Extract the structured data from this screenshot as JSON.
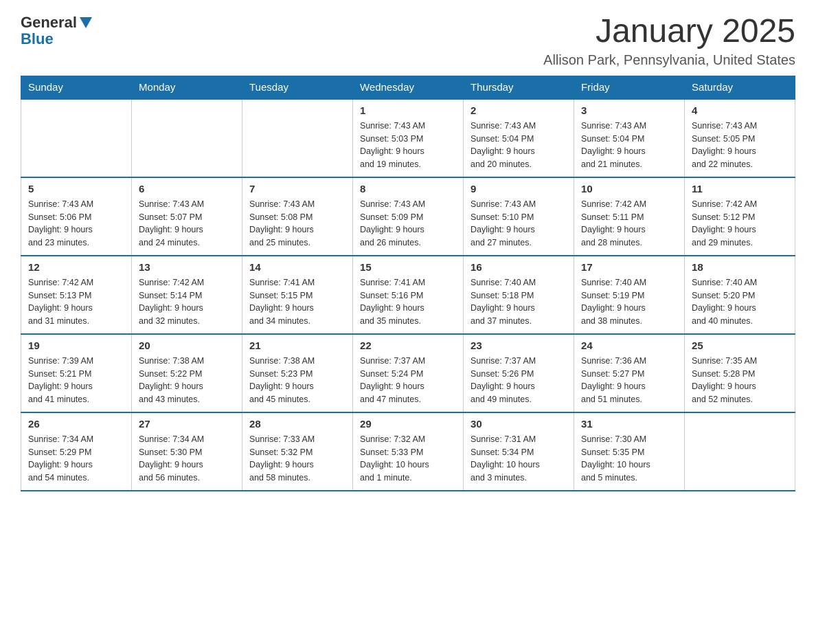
{
  "header": {
    "logo": {
      "general": "General",
      "blue": "Blue"
    },
    "month_title": "January 2025",
    "location": "Allison Park, Pennsylvania, United States"
  },
  "weekdays": [
    "Sunday",
    "Monday",
    "Tuesday",
    "Wednesday",
    "Thursday",
    "Friday",
    "Saturday"
  ],
  "weeks": [
    [
      {
        "day": "",
        "info": ""
      },
      {
        "day": "",
        "info": ""
      },
      {
        "day": "",
        "info": ""
      },
      {
        "day": "1",
        "info": "Sunrise: 7:43 AM\nSunset: 5:03 PM\nDaylight: 9 hours\nand 19 minutes."
      },
      {
        "day": "2",
        "info": "Sunrise: 7:43 AM\nSunset: 5:04 PM\nDaylight: 9 hours\nand 20 minutes."
      },
      {
        "day": "3",
        "info": "Sunrise: 7:43 AM\nSunset: 5:04 PM\nDaylight: 9 hours\nand 21 minutes."
      },
      {
        "day": "4",
        "info": "Sunrise: 7:43 AM\nSunset: 5:05 PM\nDaylight: 9 hours\nand 22 minutes."
      }
    ],
    [
      {
        "day": "5",
        "info": "Sunrise: 7:43 AM\nSunset: 5:06 PM\nDaylight: 9 hours\nand 23 minutes."
      },
      {
        "day": "6",
        "info": "Sunrise: 7:43 AM\nSunset: 5:07 PM\nDaylight: 9 hours\nand 24 minutes."
      },
      {
        "day": "7",
        "info": "Sunrise: 7:43 AM\nSunset: 5:08 PM\nDaylight: 9 hours\nand 25 minutes."
      },
      {
        "day": "8",
        "info": "Sunrise: 7:43 AM\nSunset: 5:09 PM\nDaylight: 9 hours\nand 26 minutes."
      },
      {
        "day": "9",
        "info": "Sunrise: 7:43 AM\nSunset: 5:10 PM\nDaylight: 9 hours\nand 27 minutes."
      },
      {
        "day": "10",
        "info": "Sunrise: 7:42 AM\nSunset: 5:11 PM\nDaylight: 9 hours\nand 28 minutes."
      },
      {
        "day": "11",
        "info": "Sunrise: 7:42 AM\nSunset: 5:12 PM\nDaylight: 9 hours\nand 29 minutes."
      }
    ],
    [
      {
        "day": "12",
        "info": "Sunrise: 7:42 AM\nSunset: 5:13 PM\nDaylight: 9 hours\nand 31 minutes."
      },
      {
        "day": "13",
        "info": "Sunrise: 7:42 AM\nSunset: 5:14 PM\nDaylight: 9 hours\nand 32 minutes."
      },
      {
        "day": "14",
        "info": "Sunrise: 7:41 AM\nSunset: 5:15 PM\nDaylight: 9 hours\nand 34 minutes."
      },
      {
        "day": "15",
        "info": "Sunrise: 7:41 AM\nSunset: 5:16 PM\nDaylight: 9 hours\nand 35 minutes."
      },
      {
        "day": "16",
        "info": "Sunrise: 7:40 AM\nSunset: 5:18 PM\nDaylight: 9 hours\nand 37 minutes."
      },
      {
        "day": "17",
        "info": "Sunrise: 7:40 AM\nSunset: 5:19 PM\nDaylight: 9 hours\nand 38 minutes."
      },
      {
        "day": "18",
        "info": "Sunrise: 7:40 AM\nSunset: 5:20 PM\nDaylight: 9 hours\nand 40 minutes."
      }
    ],
    [
      {
        "day": "19",
        "info": "Sunrise: 7:39 AM\nSunset: 5:21 PM\nDaylight: 9 hours\nand 41 minutes."
      },
      {
        "day": "20",
        "info": "Sunrise: 7:38 AM\nSunset: 5:22 PM\nDaylight: 9 hours\nand 43 minutes."
      },
      {
        "day": "21",
        "info": "Sunrise: 7:38 AM\nSunset: 5:23 PM\nDaylight: 9 hours\nand 45 minutes."
      },
      {
        "day": "22",
        "info": "Sunrise: 7:37 AM\nSunset: 5:24 PM\nDaylight: 9 hours\nand 47 minutes."
      },
      {
        "day": "23",
        "info": "Sunrise: 7:37 AM\nSunset: 5:26 PM\nDaylight: 9 hours\nand 49 minutes."
      },
      {
        "day": "24",
        "info": "Sunrise: 7:36 AM\nSunset: 5:27 PM\nDaylight: 9 hours\nand 51 minutes."
      },
      {
        "day": "25",
        "info": "Sunrise: 7:35 AM\nSunset: 5:28 PM\nDaylight: 9 hours\nand 52 minutes."
      }
    ],
    [
      {
        "day": "26",
        "info": "Sunrise: 7:34 AM\nSunset: 5:29 PM\nDaylight: 9 hours\nand 54 minutes."
      },
      {
        "day": "27",
        "info": "Sunrise: 7:34 AM\nSunset: 5:30 PM\nDaylight: 9 hours\nand 56 minutes."
      },
      {
        "day": "28",
        "info": "Sunrise: 7:33 AM\nSunset: 5:32 PM\nDaylight: 9 hours\nand 58 minutes."
      },
      {
        "day": "29",
        "info": "Sunrise: 7:32 AM\nSunset: 5:33 PM\nDaylight: 10 hours\nand 1 minute."
      },
      {
        "day": "30",
        "info": "Sunrise: 7:31 AM\nSunset: 5:34 PM\nDaylight: 10 hours\nand 3 minutes."
      },
      {
        "day": "31",
        "info": "Sunrise: 7:30 AM\nSunset: 5:35 PM\nDaylight: 10 hours\nand 5 minutes."
      },
      {
        "day": "",
        "info": ""
      }
    ]
  ]
}
